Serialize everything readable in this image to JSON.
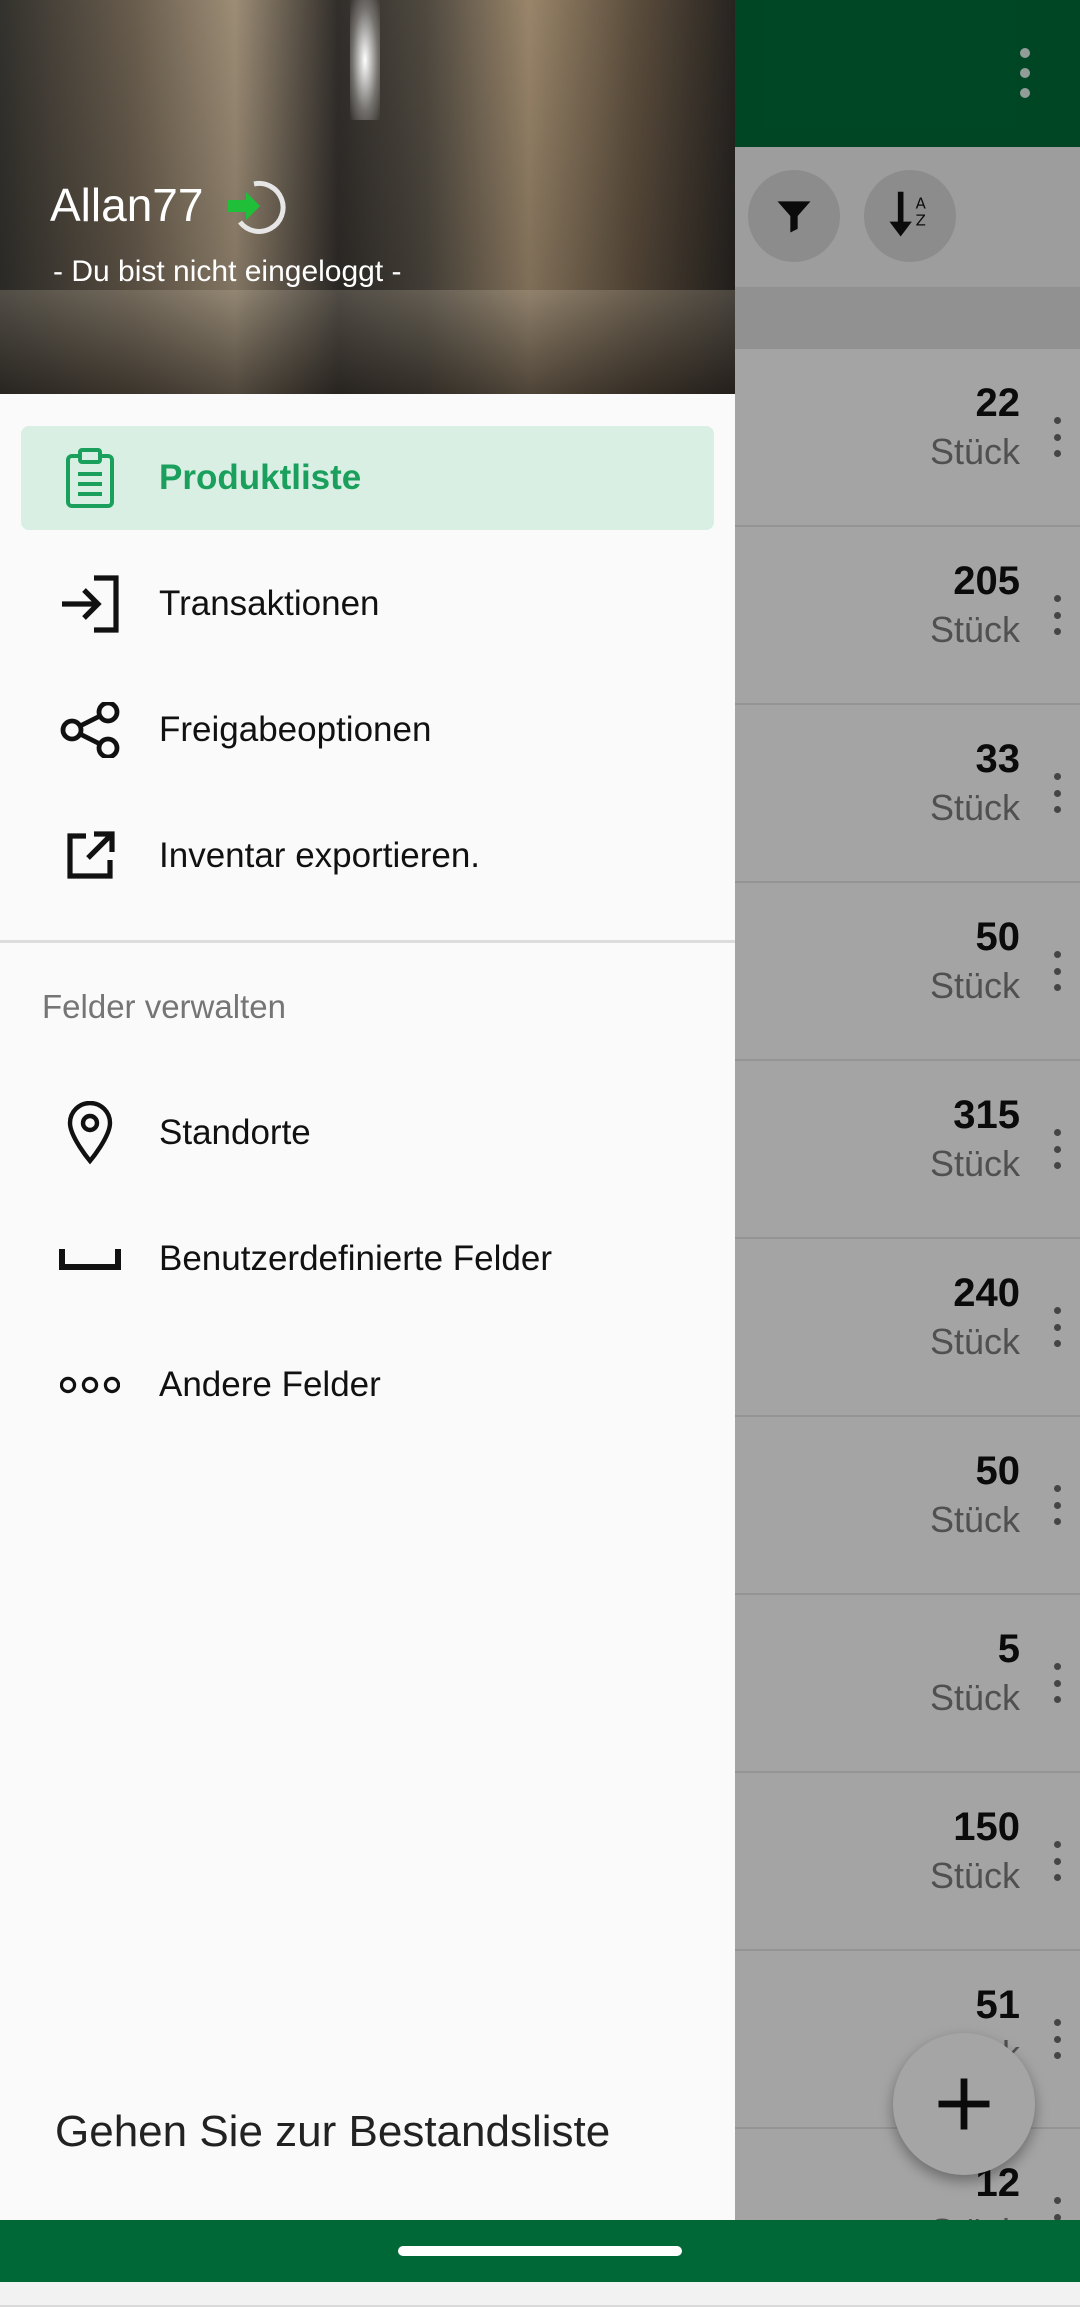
{
  "drawer": {
    "username": "Allan77",
    "login_status": "- Du bist nicht eingeloggt -",
    "items": [
      {
        "label": "Produktliste",
        "icon": "clipboard-icon",
        "active": true
      },
      {
        "label": "Transaktionen",
        "icon": "login-arrow-icon"
      },
      {
        "label": "Freigabeoptionen",
        "icon": "share-icon"
      },
      {
        "label": "Inventar exportieren.",
        "icon": "export-icon"
      }
    ],
    "section_label": "Felder verwalten",
    "field_items": [
      {
        "label": "Standorte",
        "icon": "location-pin-icon"
      },
      {
        "label": "Benutzerdefinierte Felder",
        "icon": "space-bar-icon"
      },
      {
        "label": "Andere Felder",
        "icon": "three-circles-icon"
      }
    ],
    "footer_link": "Gehen Sie zur Bestandsliste"
  },
  "list": {
    "rows": [
      {
        "qty": "22",
        "unit": "Stück"
      },
      {
        "qty": "205",
        "unit": "Stück"
      },
      {
        "qty": "33",
        "unit": "Stück"
      },
      {
        "qty": "50",
        "unit": "Stück"
      },
      {
        "qty": "315",
        "unit": "Stück"
      },
      {
        "qty": "240",
        "unit": "Stück"
      },
      {
        "qty": "50",
        "unit": "Stück"
      },
      {
        "qty": "5",
        "unit": "Stück"
      },
      {
        "qty": "150",
        "unit": "Stück"
      },
      {
        "qty": "51",
        "unit": "Stück"
      },
      {
        "qty": "12",
        "unit": "Stück"
      }
    ]
  },
  "colors": {
    "brand": "#006837",
    "accent": "#1aa05c",
    "active_bg": "#d9efe3"
  }
}
